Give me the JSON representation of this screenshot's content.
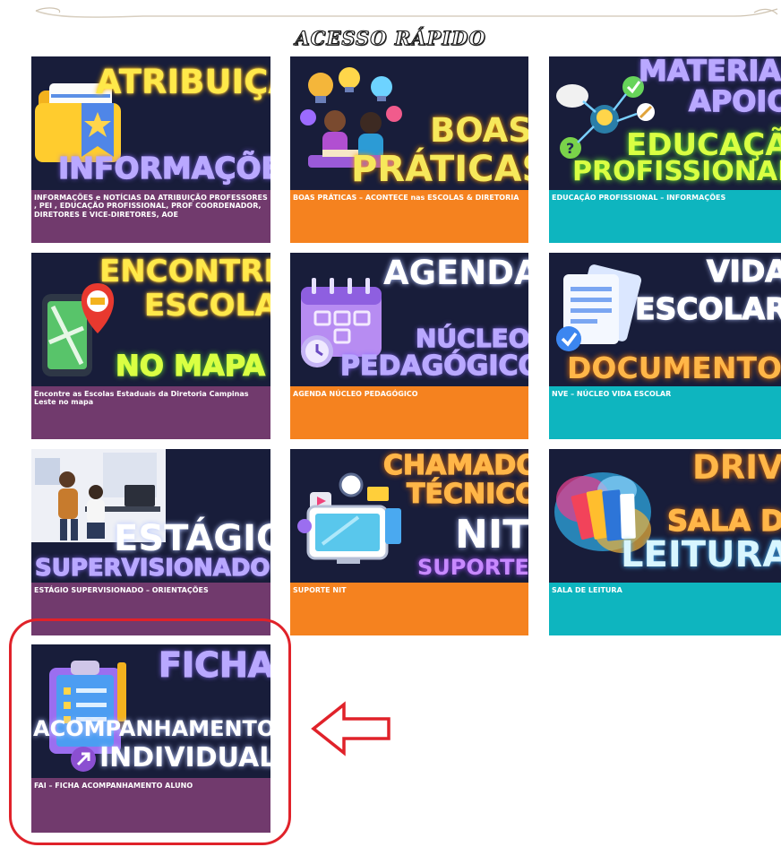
{
  "section": {
    "title": "ACESSO RÁPIDO"
  },
  "colors": {
    "purple": "#713a6d",
    "orange": "#f5821f",
    "teal": "#0eb5bf",
    "card_bg": "#181d3a",
    "highlight": "#e0222a"
  },
  "cards": [
    {
      "title1": "ATRIBUIÇÃO",
      "title2": "INFORMAÇÕES",
      "caption": "INFORMAÇÕES e NOTÍCIAS DA ATRIBUIÇÃO PROFESSORES , PEI , EDUCAÇÃO PROFISSIONAL, PROF COORDENADOR, DIRETORES E VICE-DIRETORES, AOE",
      "icon": "folder-star-icon"
    },
    {
      "title1": "BOAS",
      "title2": "PRÁTICAS",
      "caption": "BOAS PRÁTICAS – ACONTECE nas ESCOLAS & DIRETORIA",
      "icon": "lightbulb-people-icon"
    },
    {
      "title1": "MATERIAL",
      "title2": "APOIO",
      "title3": "EDUCAÇÃO",
      "title4": "PROFISSIONAL",
      "caption": "EDUCAÇÃO PROFISSIONAL – INFORMAÇÕES",
      "icon": "idea-network-icon"
    },
    {
      "title1": "ENCONTRE",
      "title2": "ESCOLA",
      "title3": "NO MAPA",
      "caption": "Encontre as Escolas Estaduais da Diretoria Campinas Leste no mapa",
      "icon": "map-pin-icon"
    },
    {
      "title1": "AGENDA",
      "title2": "NÚCLEO",
      "title3": "PEDAGÓGICO",
      "caption": "AGENDA NÚCLEO PEDAGÓGICO",
      "icon": "calendar-clock-icon"
    },
    {
      "title1": "VIDA",
      "title2": "ESCOLAR",
      "title3": "DOCUMENTOS",
      "caption": "NVE – NÚCLEO VIDA ESCOLAR",
      "icon": "documents-check-icon"
    },
    {
      "title1": "ESTÁGIO",
      "title2": "SUPERVISIONADO",
      "caption": "ESTÁGIO SUPERVISIONADO – ORIENTAÇÕES",
      "icon": "office-people-icon"
    },
    {
      "title1": "CHAMADO",
      "title2": "TÉCNICO",
      "title3": "NIT",
      "title4": "SUPORTE",
      "caption": "SUPORTE NIT",
      "icon": "monitor-support-icon"
    },
    {
      "title1": "DRIVE",
      "title2": "SALA DE",
      "title3": "LEITURA",
      "caption": "SALA DE LEITURA",
      "icon": "books-splash-icon"
    },
    {
      "title1": "FICHA",
      "title2": "ACOMPANHAMENTO",
      "title3": "INDIVIDUAL",
      "caption": "FAI – FICHA ACOMPANHAMENTO ALUNO",
      "icon": "clipboard-pencil-icon"
    }
  ]
}
